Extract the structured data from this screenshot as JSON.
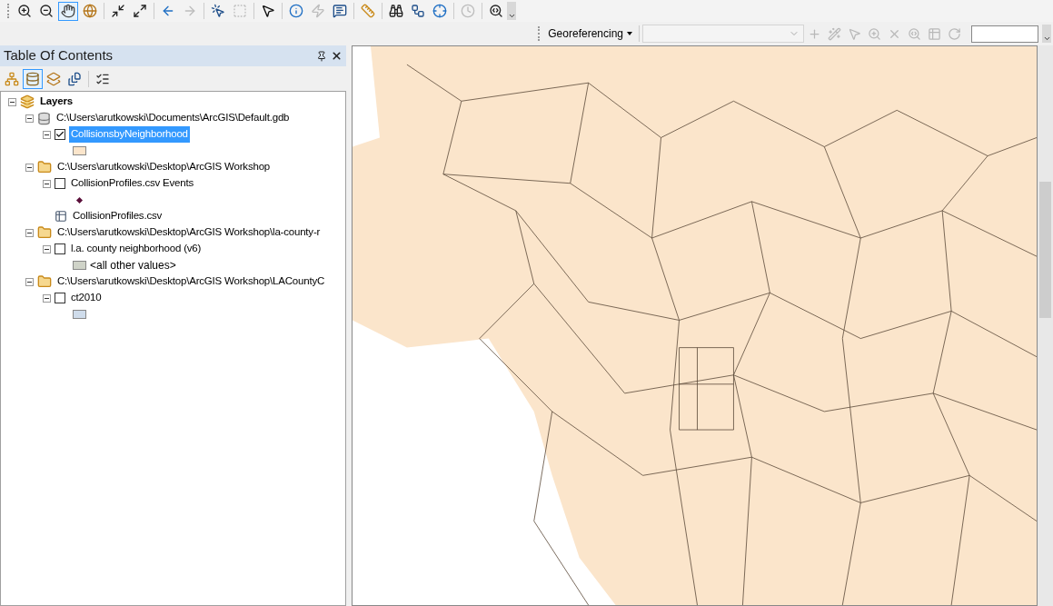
{
  "main_toolbar": [
    {
      "kind": "zoom-in",
      "selected": false,
      "disabled": false
    },
    {
      "kind": "zoom-out",
      "selected": false,
      "disabled": false
    },
    {
      "kind": "pan",
      "selected": true,
      "disabled": false
    },
    {
      "kind": "full-extent",
      "selected": false,
      "disabled": false
    },
    {
      "kind": "separator"
    },
    {
      "kind": "fixed-zoom-in",
      "selected": false,
      "disabled": false
    },
    {
      "kind": "fixed-zoom-out",
      "selected": false,
      "disabled": false
    },
    {
      "kind": "separator"
    },
    {
      "kind": "back",
      "selected": false,
      "disabled": false
    },
    {
      "kind": "forward",
      "selected": false,
      "disabled": true
    },
    {
      "kind": "separator"
    },
    {
      "kind": "select-features",
      "selected": false,
      "disabled": false
    },
    {
      "kind": "clear-selection",
      "selected": false,
      "disabled": true
    },
    {
      "kind": "separator"
    },
    {
      "kind": "select-elements",
      "selected": false,
      "disabled": false
    },
    {
      "kind": "separator"
    },
    {
      "kind": "identify",
      "selected": false,
      "disabled": false
    },
    {
      "kind": "hyperlink",
      "selected": false,
      "disabled": true
    },
    {
      "kind": "html-popup",
      "selected": false,
      "disabled": false
    },
    {
      "kind": "separator"
    },
    {
      "kind": "measure",
      "selected": false,
      "disabled": false
    },
    {
      "kind": "separator"
    },
    {
      "kind": "find",
      "selected": false,
      "disabled": false
    },
    {
      "kind": "route",
      "selected": false,
      "disabled": false
    },
    {
      "kind": "go-to-xy",
      "selected": false,
      "disabled": false
    },
    {
      "kind": "separator"
    },
    {
      "kind": "time-slider",
      "selected": false,
      "disabled": true
    },
    {
      "kind": "separator"
    },
    {
      "kind": "magnifier",
      "selected": false,
      "disabled": false
    }
  ],
  "georeferencing_toolbar": {
    "menu": "Georeferencing",
    "layer_combo": {
      "disabled": true
    },
    "tools": [
      {
        "kind": "add-control-points",
        "disabled": true
      },
      {
        "kind": "auto-registration",
        "disabled": true
      },
      {
        "kind": "select-link",
        "disabled": true
      },
      {
        "kind": "zoom-to-link",
        "disabled": true
      },
      {
        "kind": "delete-link",
        "disabled": true
      },
      {
        "kind": "viewer",
        "disabled": true
      },
      {
        "kind": "link-table",
        "disabled": true
      },
      {
        "kind": "rotate",
        "disabled": true
      }
    ]
  },
  "table_of_contents": {
    "title": "Table Of Contents",
    "views": [
      {
        "kind": "list-by-drawing-order",
        "selected": false
      },
      {
        "kind": "list-by-source",
        "selected": true
      },
      {
        "kind": "list-by-visibility",
        "selected": false
      },
      {
        "kind": "list-by-selection",
        "selected": false
      },
      {
        "kind": "options",
        "selected": false
      }
    ],
    "tree": [
      {
        "kind": "dataframe",
        "label": "Layers",
        "expanded": true,
        "children": [
          {
            "kind": "geodatabase",
            "label": "C:\\Users\\arutkowski\\Documents\\ArcGIS\\Default.gdb",
            "expanded": true,
            "children": [
              {
                "kind": "layer",
                "label": "CollisionsbyNeighborhood",
                "checked": true,
                "selected": true,
                "expanded": true,
                "children": [
                  {
                    "kind": "swatch",
                    "color": "#fbe5cb"
                  }
                ]
              }
            ]
          },
          {
            "kind": "folder",
            "label": "C:\\Users\\arutkowski\\Desktop\\ArcGIS Workshop",
            "expanded": true,
            "children": [
              {
                "kind": "layer",
                "label": "CollisionProfiles.csv Events",
                "checked": false,
                "selected": false,
                "expanded": true,
                "children": [
                  {
                    "kind": "point",
                    "color": "#5a0f3a"
                  }
                ]
              },
              {
                "kind": "table",
                "label": "CollisionProfiles.csv"
              }
            ]
          },
          {
            "kind": "folder",
            "label": "C:\\Users\\arutkowski\\Desktop\\ArcGIS Workshop\\la-county-r",
            "expanded": true,
            "children": [
              {
                "kind": "layer",
                "label": "l.a. county neighborhood (v6)",
                "checked": false,
                "selected": false,
                "expanded": true,
                "children": [
                  {
                    "kind": "swatch",
                    "color": "#cfd3c8",
                    "label": "<all other values>"
                  }
                ]
              }
            ]
          },
          {
            "kind": "folder",
            "label": "C:\\Users\\arutkowski\\Desktop\\ArcGIS Workshop\\LACountyC",
            "expanded": true,
            "children": [
              {
                "kind": "layer",
                "label": "ct2010",
                "checked": false,
                "selected": false,
                "expanded": true,
                "children": [
                  {
                    "kind": "swatch",
                    "color": "#cfdceb"
                  }
                ]
              }
            ]
          }
        ]
      }
    ]
  }
}
